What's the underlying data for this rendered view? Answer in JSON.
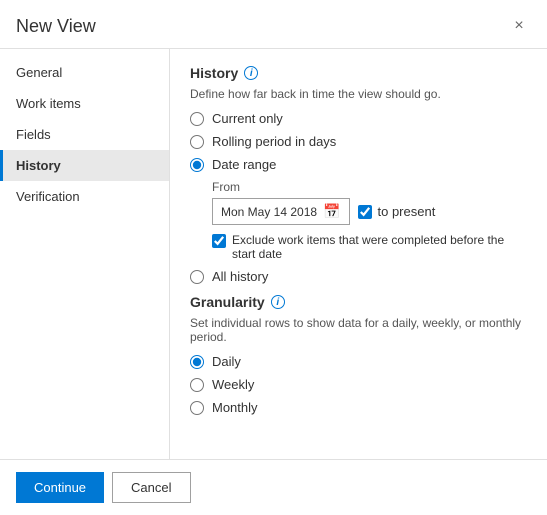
{
  "dialog": {
    "title": "New View",
    "close_label": "×"
  },
  "sidebar": {
    "items": [
      {
        "id": "general",
        "label": "General",
        "active": false
      },
      {
        "id": "work-items",
        "label": "Work items",
        "active": false
      },
      {
        "id": "fields",
        "label": "Fields",
        "active": false
      },
      {
        "id": "history",
        "label": "History",
        "active": true
      },
      {
        "id": "verification",
        "label": "Verification",
        "active": false
      }
    ]
  },
  "content": {
    "history_section": {
      "title": "History",
      "info_icon": "i",
      "description": "Define how far back in time the view should go.",
      "radio_options": [
        {
          "id": "current-only",
          "label": "Current only",
          "checked": false
        },
        {
          "id": "rolling-period",
          "label": "Rolling period in days",
          "checked": false
        },
        {
          "id": "date-range",
          "label": "Date range",
          "checked": true
        },
        {
          "id": "all-history",
          "label": "All history",
          "checked": false
        }
      ],
      "from_label": "From",
      "date_value": "Mon May 14 2018",
      "to_present_label": "to present",
      "to_present_checked": true,
      "exclude_label": "Exclude work items that were completed before the start date",
      "exclude_checked": true
    },
    "granularity_section": {
      "title": "Granularity",
      "info_icon": "i",
      "description": "Set individual rows to show data for a daily, weekly, or monthly period.",
      "radio_options": [
        {
          "id": "daily",
          "label": "Daily",
          "checked": true
        },
        {
          "id": "weekly",
          "label": "Weekly",
          "checked": false
        },
        {
          "id": "monthly",
          "label": "Monthly",
          "checked": false
        }
      ]
    }
  },
  "footer": {
    "continue_label": "Continue",
    "cancel_label": "Cancel"
  }
}
